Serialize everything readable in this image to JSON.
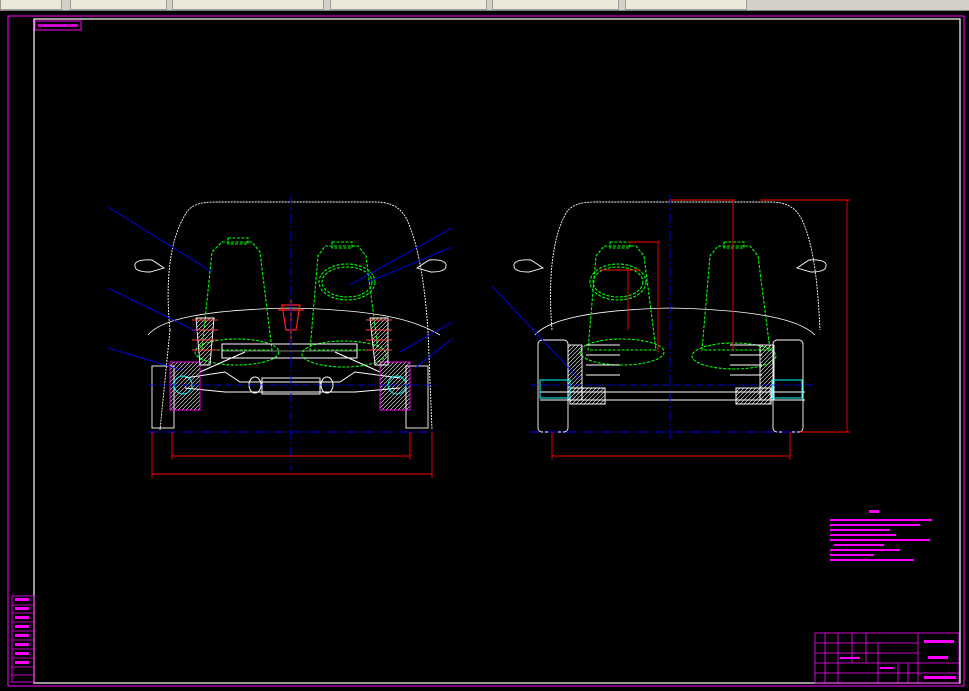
{
  "window": {
    "tabs": [
      "",
      "",
      "",
      "",
      "",
      ""
    ]
  },
  "drawing": {
    "label_top_left": "",
    "notes_title": "",
    "notes_lines": [
      "",
      "",
      "",
      "",
      "",
      "",
      "",
      ""
    ],
    "dimensions": {
      "front_track": "",
      "front_overall": "",
      "rear_track": "",
      "rear_height": "",
      "rear_height2": "",
      "rear_seat_width": "",
      "rear_seat_depth": ""
    },
    "title_block": {
      "name": "",
      "sub": "",
      "code": ""
    },
    "colors": {
      "frame": "#ff00ff",
      "dimension": "#ff0000",
      "leader": "#0000ff",
      "outline": "#ffffff",
      "seat": "#00ff00"
    }
  }
}
